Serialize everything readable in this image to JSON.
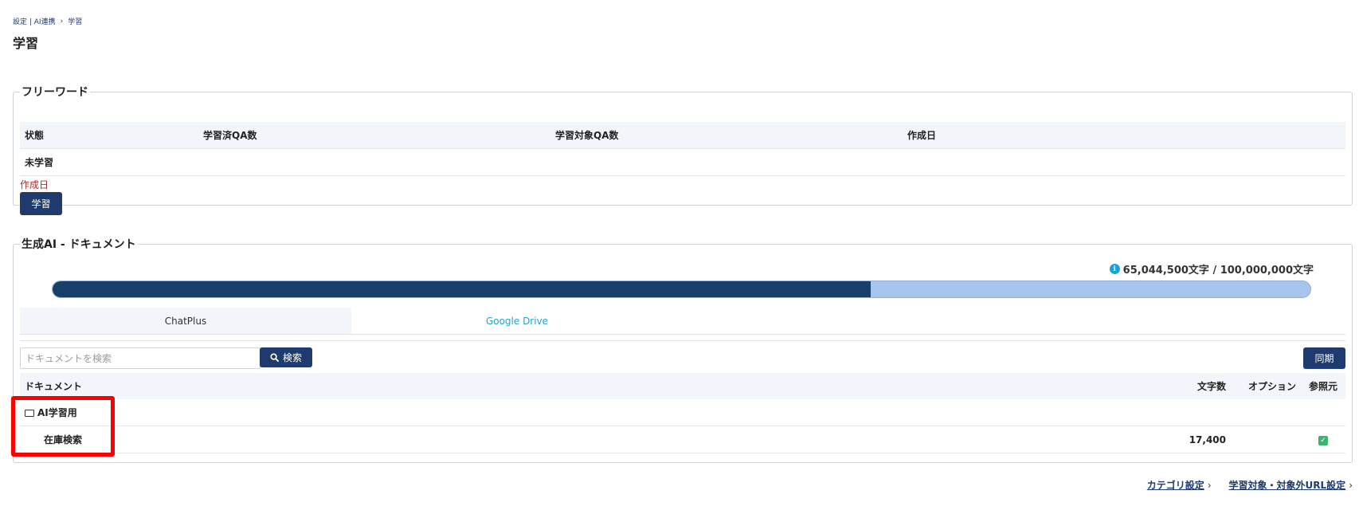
{
  "breadcrumb": {
    "parent": "設定 | AI連携",
    "separator": "›",
    "current": "学習"
  },
  "page_title": "学習",
  "freeword": {
    "legend": "フリーワード",
    "columns": [
      "状態",
      "学習済QA数",
      "学習対象QA数",
      "作成日"
    ],
    "row": [
      "未学習",
      "",
      "",
      ""
    ],
    "created_label": "作成日",
    "learn_button": "学習"
  },
  "genai": {
    "legend": "生成AI - ドキュメント",
    "usage_text": "65,044,500文字 / 100,000,000文字",
    "usage_fraction": 0.650445,
    "tabs": [
      {
        "label": "ChatPlus",
        "active": true
      },
      {
        "label": "Google Drive",
        "active": false
      }
    ],
    "search_placeholder": "ドキュメントを検索",
    "search_button": "検索",
    "sync_button": "同期",
    "columns": {
      "document": "ドキュメント",
      "chars": "文字数",
      "option": "オプション",
      "reference": "参照元"
    },
    "folder": {
      "name": "AI学習用"
    },
    "row": {
      "name": "在庫検索",
      "chars": "17,400",
      "option": "",
      "reference_checked": true
    }
  },
  "footer": {
    "category_settings": "カテゴリ設定",
    "url_settings": "学習対象・対象外URL設定"
  },
  "colors": {
    "primary": "#1e3a6e",
    "accent": "#17a8d6",
    "progress_fill": "#173f6a",
    "progress_track": "#a7c4ec",
    "highlight": "#ff0000"
  }
}
